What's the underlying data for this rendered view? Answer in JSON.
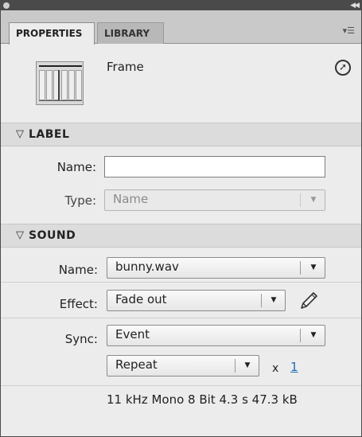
{
  "tabs": [
    {
      "label": "PROPERTIES"
    },
    {
      "label": "LIBRARY"
    }
  ],
  "header": {
    "title": "Frame"
  },
  "label_section": {
    "title": "LABEL",
    "name_label": "Name:",
    "name_value": "",
    "type_label": "Type:",
    "type_value": "Name"
  },
  "sound_section": {
    "title": "SOUND",
    "name_label": "Name:",
    "name_value": "bunny.wav",
    "effect_label": "Effect:",
    "effect_value": "Fade out",
    "sync_label": "Sync:",
    "sync_value": "Event",
    "repeat_value": "Repeat",
    "times_symbol": "x",
    "repeat_count": "1",
    "info": "11 kHz Mono 8 Bit 4.3 s 47.3 kB"
  },
  "icons": {
    "collapse": "double-chevron-left-icon",
    "panel_menu": "panel-menu-icon",
    "help": "help-arrow-icon",
    "triangle": "triangle-down-icon",
    "pencil": "pencil-icon"
  }
}
